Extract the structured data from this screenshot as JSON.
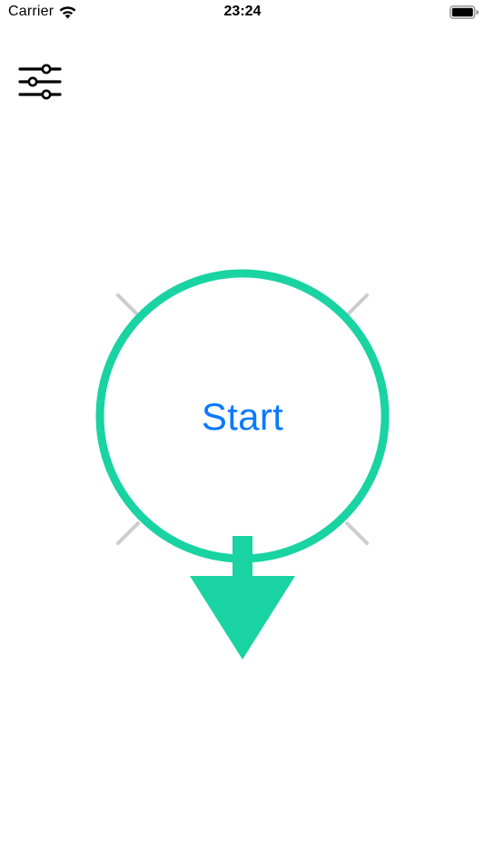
{
  "status_bar": {
    "carrier": "Carrier",
    "time": "23:24",
    "icons": [
      "wifi-icon",
      "battery-icon"
    ]
  },
  "toolbar": {
    "settings_icon": "sliders-icon"
  },
  "main": {
    "start_label": "Start",
    "direction_icon": "arrow-down-icon"
  },
  "colors": {
    "accent": "#1AD3A2",
    "link": "#0A7AFF",
    "tick": "#CCCCCC",
    "text": "#000000",
    "background": "#FFFFFF"
  }
}
